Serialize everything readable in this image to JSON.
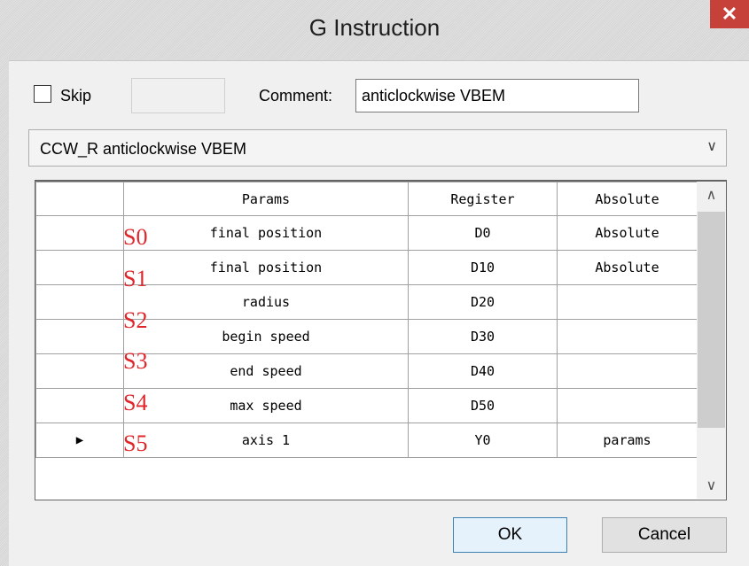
{
  "window": {
    "title": "G Instruction",
    "close_glyph": "✕"
  },
  "skip": {
    "label": "Skip",
    "checked": false
  },
  "comment": {
    "label": "Comment:",
    "value": "anticlockwise VBEM"
  },
  "instruction_select": {
    "value": "CCW_R anticlockwise VBEM",
    "arrow": "∨"
  },
  "table": {
    "headers": {
      "params": "Params",
      "register": "Register",
      "absolute": "Absolute"
    },
    "rows": [
      {
        "marker": "",
        "params": "final position",
        "register": "D0",
        "absolute": "Absolute"
      },
      {
        "marker": "",
        "params": "final position",
        "register": "D10",
        "absolute": "Absolute"
      },
      {
        "marker": "",
        "params": "radius",
        "register": "D20",
        "absolute": ""
      },
      {
        "marker": "",
        "params": "begin speed",
        "register": "D30",
        "absolute": ""
      },
      {
        "marker": "",
        "params": "end speed",
        "register": "D40",
        "absolute": ""
      },
      {
        "marker": "",
        "params": "max speed",
        "register": "D50",
        "absolute": ""
      },
      {
        "marker": "▶",
        "params": "axis 1",
        "register": "Y0",
        "absolute": "params"
      }
    ],
    "scroll_up": "∧",
    "scroll_down": "∨"
  },
  "annotations": {
    "s0": "S0",
    "s1": "S1",
    "s2": "S2",
    "s3": "S3",
    "s4": "S4",
    "s5": "S5",
    "color": "#e0262b"
  },
  "buttons": {
    "ok": "OK",
    "cancel": "Cancel"
  }
}
